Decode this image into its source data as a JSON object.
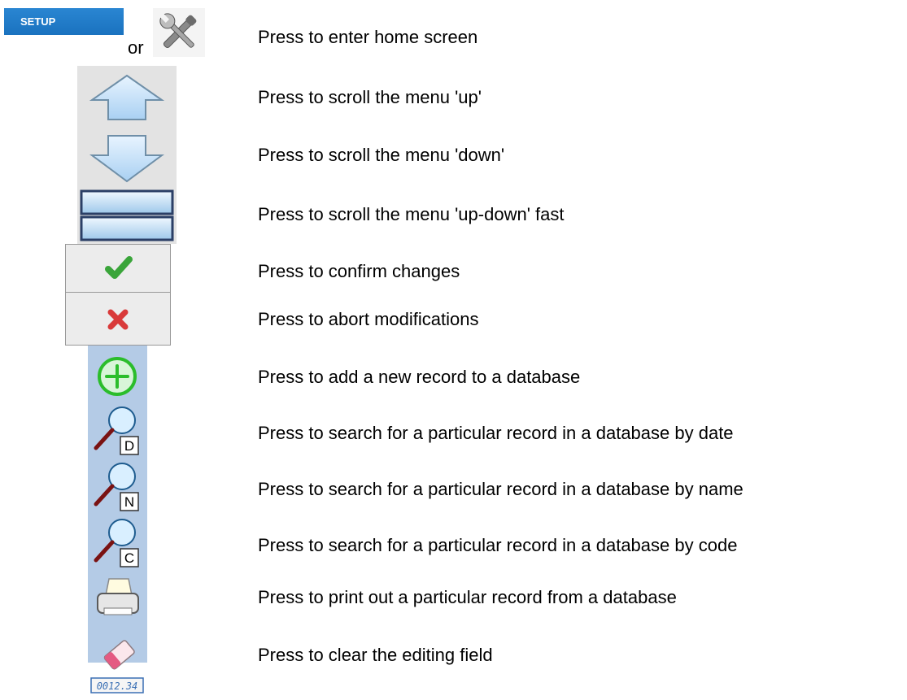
{
  "setup": {
    "button_label": "SETUP",
    "or_text": "or",
    "desc": "Press to enter home screen",
    "icon": "wrench-screwdriver-icon"
  },
  "rows": [
    {
      "icon": "arrow-up-icon",
      "desc": "Press to scroll the menu 'up'"
    },
    {
      "icon": "arrow-down-icon",
      "desc": "Press to scroll the menu 'down'"
    },
    {
      "icon": "scroll-fast-icon",
      "desc": "Press to scroll the menu 'up-down' fast"
    },
    {
      "icon": "checkmark-icon",
      "desc": "Press to confirm changes"
    },
    {
      "icon": "cross-icon",
      "desc": "Press to abort modifications"
    },
    {
      "icon": "add-record-icon",
      "desc": "Press to add a new record to a database"
    },
    {
      "icon": "search-by-date-icon",
      "letter": "D",
      "desc": "Press to search for a particular record in a database by date"
    },
    {
      "icon": "search-by-name-icon",
      "letter": "N",
      "desc": "Press to search for a particular record in a database by name"
    },
    {
      "icon": "search-by-code-icon",
      "letter": "C",
      "desc": "Press to search for a particular record in a database by code"
    },
    {
      "icon": "printer-icon",
      "desc": "Press to print out a particular record from a database"
    },
    {
      "icon": "eraser-icon",
      "display": "0012.34",
      "desc": "Press to clear the editing field"
    }
  ],
  "colors": {
    "setup_blue": "#1f78c8",
    "check_green": "#3aa53a",
    "cross_red": "#d93a3a",
    "strip_blue": "#b4cbe6"
  }
}
